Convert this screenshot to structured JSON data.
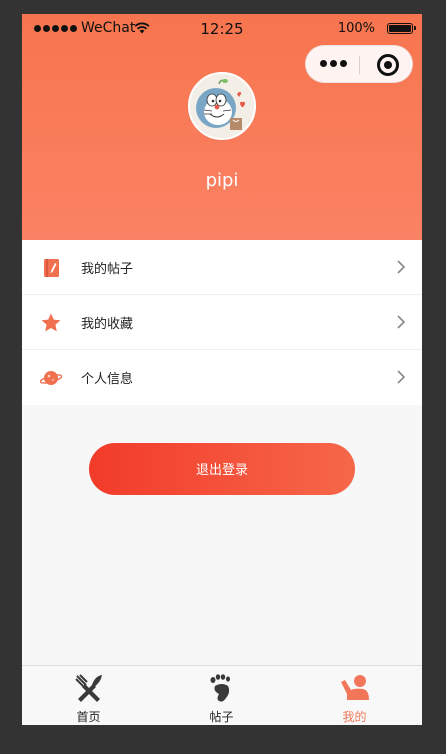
{
  "status_bar": {
    "carrier": "WeChat",
    "time": "12:25",
    "battery": "100%"
  },
  "profile": {
    "username": "pipi"
  },
  "menu": {
    "items": [
      {
        "label": "我的帖子",
        "icon": "notebook-icon"
      },
      {
        "label": "我的收藏",
        "icon": "star-icon"
      },
      {
        "label": "个人信息",
        "icon": "planet-icon"
      }
    ]
  },
  "logout": {
    "label": "退出登录"
  },
  "tabbar": {
    "items": [
      {
        "label": "首页",
        "icon": "utensils-icon",
        "active": false
      },
      {
        "label": "帖子",
        "icon": "footprint-icon",
        "active": false
      },
      {
        "label": "我的",
        "icon": "person-icon",
        "active": true
      }
    ]
  },
  "colors": {
    "header_top": "#f7754e",
    "header_bottom": "#fb8264",
    "accent": "#f2775a",
    "button_start": "#f23b2a",
    "button_end": "#f6674a",
    "icon_orange": "#f07050"
  }
}
